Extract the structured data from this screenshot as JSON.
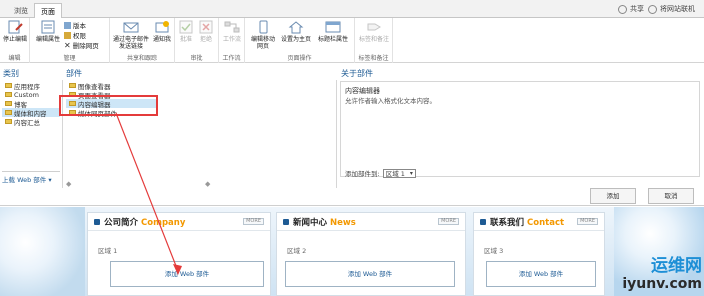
{
  "tabs": [
    "浏览",
    "页面"
  ],
  "topright": {
    "share": "共享",
    "followsite": "将网站联机"
  },
  "ribbon": {
    "edit_group": {
      "button": "停止编辑",
      "label": "编辑"
    },
    "manage_group": {
      "edit_props": "编辑属性",
      "version": "版本",
      "permissions": "权限",
      "delete_page": "删除网页",
      "label": "管理"
    },
    "share_group": {
      "email_link": "通过电子邮件发送链接",
      "alert_me": "通知我",
      "label": "共享和跟踪"
    },
    "approve_group": {
      "approve": "批准",
      "reject": "拒绝",
      "label": "审批"
    },
    "workflow_group": {
      "workflow": "工作流",
      "label": "工作流"
    },
    "page_actions_group": {
      "edit_mobile": "编辑移动网页",
      "set_home": "设置为主页",
      "title_bar": "标题栏属性",
      "label": "页面操作"
    },
    "tags_group": {
      "tags": "标签和备注",
      "label": "标签和备注"
    }
  },
  "panel": {
    "categories_title": "类别",
    "parts_title": "部件",
    "about_title": "关于部件",
    "categories": [
      "应用程序",
      "Custom",
      "博客",
      "媒体和内容",
      "内容汇总"
    ],
    "selected_category": 3,
    "upload": "上载 Web 部件 ▾",
    "parts": [
      "图像查看器",
      "页面查看器",
      "内容编辑器",
      "媒体网页部件",
      "视频播放器"
    ],
    "selected_part": 2,
    "about_name": "内容编辑器",
    "about_desc": "允许作者输入格式化文本内容。",
    "zone_label": "添加部件到:",
    "zone_value": "区域 1",
    "add_button": "添加",
    "cancel_button": "取消"
  },
  "portal": {
    "boxes": [
      {
        "cn": "公司简介",
        "en": "Company",
        "zone": "区域 1",
        "add": "添加 Web 部件"
      },
      {
        "cn": "新闻中心",
        "en": "News",
        "zone": "区域 2",
        "add": "添加 Web 部件"
      },
      {
        "cn": "联系我们",
        "en": "Contact",
        "zone": "区域 3",
        "add": "添加 Web 部件"
      }
    ],
    "more": "MORE"
  },
  "watermark": {
    "line1": "运维网",
    "line2": "iyunv.com"
  },
  "colors": {
    "accent": "#1e5b94",
    "highlight": "#e43b3b",
    "orange": "#f39800"
  }
}
